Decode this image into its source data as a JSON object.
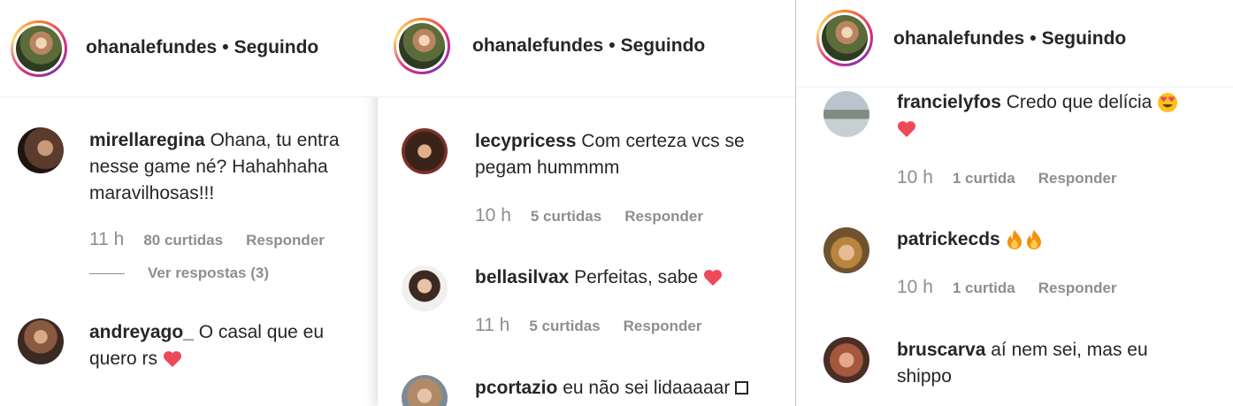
{
  "panels": [
    {
      "header": {
        "username": "ohanalefundes",
        "separator": "•",
        "follow_status": "Seguindo"
      },
      "comments": [
        {
          "username": "mirellaregina",
          "text": "Ohana, tu entra nesse game né? Hahahhaha maravilhosas!!!",
          "time": "11 h",
          "likes": "80 curtidas",
          "reply": "Responder",
          "view_replies": "Ver respostas (3)"
        },
        {
          "username": "andreyago_",
          "text": "O casal que eu quero rs",
          "emoji": [
            "red-heart"
          ]
        }
      ]
    },
    {
      "header": {
        "username": "ohanalefundes",
        "separator": "•",
        "follow_status": "Seguindo"
      },
      "comments": [
        {
          "username": "lecypricess",
          "text": "Com certeza vcs se pegam hummmm",
          "time": "10 h",
          "likes": "5 curtidas",
          "reply": "Responder"
        },
        {
          "username": "bellasilvax",
          "text": "Perfeitas, sabe",
          "emoji": [
            "red-heart"
          ],
          "time": "11 h",
          "likes": "5 curtidas",
          "reply": "Responder"
        },
        {
          "username": "pcortazio",
          "text": "eu não sei lidaaaaar"
        }
      ]
    },
    {
      "header": {
        "username": "ohanalefundes",
        "separator": "•",
        "follow_status": "Seguindo"
      },
      "comments": [
        {
          "username": "francielyfos",
          "text": "Credo que delícia",
          "emoji": [
            "heart-eyes",
            "red-heart"
          ],
          "time": "10 h",
          "likes": "1 curtida",
          "reply": "Responder"
        },
        {
          "username": "patrickecds",
          "text": "",
          "emoji": [
            "fire",
            "fire"
          ],
          "time": "10 h",
          "likes": "1 curtida",
          "reply": "Responder"
        },
        {
          "username": "bruscarva",
          "text": "aí nem sei, mas eu shippo"
        }
      ]
    }
  ],
  "colors": {
    "text": "#262626",
    "meta": "#8e8e8e",
    "heart": "#ed4956"
  }
}
